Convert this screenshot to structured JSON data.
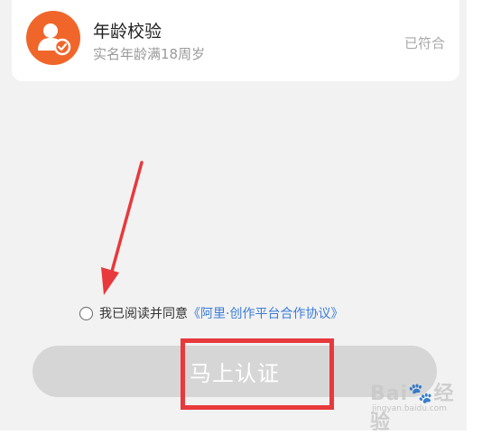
{
  "age_check": {
    "title": "年龄校验",
    "subtitle": "实名年龄满18周岁",
    "status": "已符合",
    "icon": "user-verified-icon",
    "icon_color": "#f0662a"
  },
  "agreement": {
    "checked": false,
    "text": "我已阅读并同意",
    "link": "《阿里·创作平台合作协议》",
    "link_color": "#3b7cd8"
  },
  "cta": {
    "label": "马上认证",
    "enabled": false
  },
  "annotation": {
    "arrow_color": "#e8393c",
    "box_color": "#e8393c"
  },
  "watermark": {
    "brand": "Bai🐾经验",
    "url": "jingyan.baidu.com"
  }
}
